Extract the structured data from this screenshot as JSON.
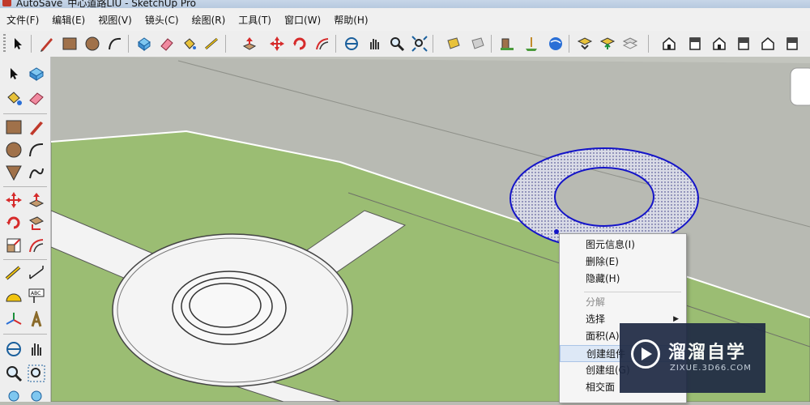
{
  "window": {
    "title": "AutoSave_中心道路LIU - SketchUp Pro"
  },
  "menu": [
    "文件(F)",
    "编辑(E)",
    "视图(V)",
    "镜头(C)",
    "绘图(R)",
    "工具(T)",
    "窗口(W)",
    "帮助(H)"
  ],
  "top_toolbar": [
    "select-icon",
    "pencil-icon",
    "rectangle-icon",
    "circle-icon",
    "arc-icon",
    "make-component-icon",
    "eraser-icon",
    "paint-bucket-icon",
    "push-pull-icon",
    "move-icon",
    "rotate-icon",
    "offset-icon",
    "orbit-icon",
    "pan-icon",
    "zoom-icon",
    "zoom-extents-icon",
    "get-models-icon",
    "share-model-icon",
    "add-location-icon",
    "toggle-terrain-icon",
    "google-earth-icon",
    "component-tools-icon",
    "share-component-icon",
    "dynamic-components-icon",
    "iso-view-icon",
    "top-view-icon",
    "front-view-icon",
    "right-view-icon",
    "back-view-icon",
    "left-view-icon"
  ],
  "left_toolbar": [
    "select-icon",
    "make-component-icon",
    "paint-bucket-icon",
    "eraser-icon",
    "rectangle-icon",
    "line-icon",
    "circle-icon",
    "arc-icon",
    "polygon-icon",
    "freehand-icon",
    "move-icon",
    "push-pull-icon",
    "rotate-icon",
    "follow-me-icon",
    "scale-icon",
    "offset-icon",
    "tape-measure-icon",
    "dimension-icon",
    "protractor-icon",
    "text-icon",
    "axes-icon",
    "3d-text-icon",
    "orbit-icon",
    "pan-icon",
    "zoom-icon",
    "zoom-window-icon"
  ],
  "context_menu": [
    {
      "label": "图元信息(I)",
      "enabled": true
    },
    {
      "label": "删除(E)",
      "enabled": true
    },
    {
      "label": "隐藏(H)",
      "enabled": true
    },
    {
      "label": "分解",
      "enabled": false
    },
    {
      "label": "选择",
      "enabled": true,
      "submenu": true
    },
    {
      "label": "面积(A)",
      "enabled": true
    },
    {
      "label": "创建组件",
      "enabled": true,
      "highlighted": true
    },
    {
      "label": "创建组(G)",
      "enabled": true
    },
    {
      "label": "相交面",
      "enabled": true
    }
  ],
  "watermark": {
    "title": "溜溜自学",
    "url": "ZIXUE.3D66.COM"
  },
  "colors": {
    "grass": "#99bb72",
    "road": "#b7b9b2",
    "selection": "#1a1ad0",
    "menu_bg": "#f0f0f0"
  }
}
